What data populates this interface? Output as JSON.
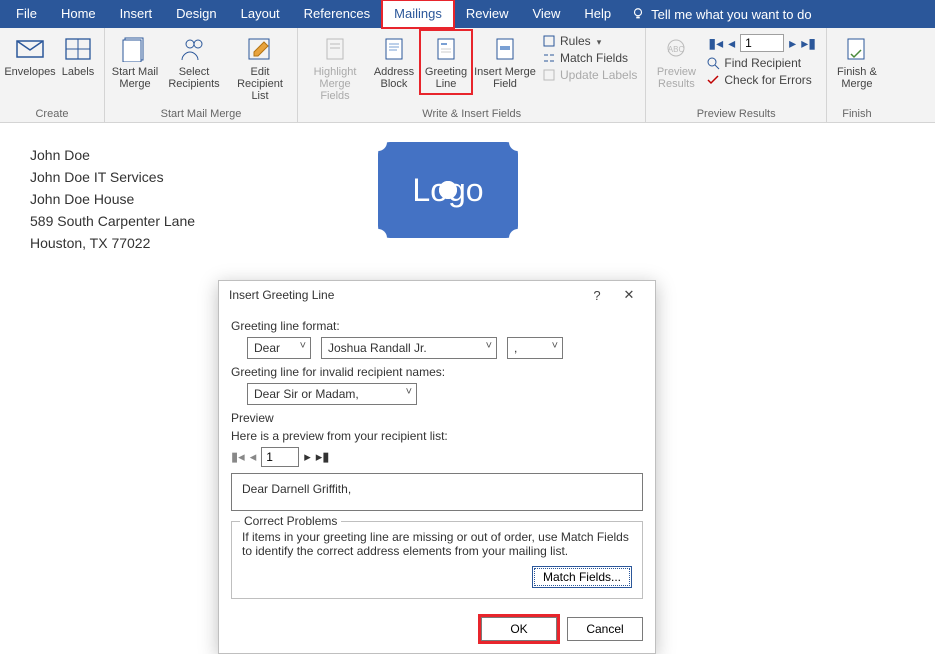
{
  "menubar": {
    "items": [
      "File",
      "Home",
      "Insert",
      "Design",
      "Layout",
      "References",
      "Mailings",
      "Review",
      "View",
      "Help"
    ],
    "active": "Mailings",
    "tell_me": "Tell me what you want to do"
  },
  "ribbon": {
    "create": {
      "label": "Create",
      "envelopes": "Envelopes",
      "labels": "Labels"
    },
    "start": {
      "label": "Start Mail Merge",
      "start_merge": "Start Mail\nMerge",
      "select_recip": "Select\nRecipients",
      "edit_recip": "Edit\nRecipient List"
    },
    "write": {
      "label": "Write & Insert Fields",
      "highlight": "Highlight\nMerge Fields",
      "address": "Address\nBlock",
      "greeting": "Greeting\nLine",
      "insert_merge": "Insert Merge\nField",
      "rules": "Rules",
      "match_fields": "Match Fields",
      "update_labels": "Update Labels"
    },
    "preview": {
      "label": "Preview Results",
      "preview_results": "Preview\nResults",
      "record_num": "1",
      "find_recip": "Find Recipient",
      "check_errors": "Check for Errors"
    },
    "finish": {
      "label": "Finish",
      "finish_merge": "Finish &\nMerge"
    }
  },
  "document": {
    "lines": [
      "John Doe",
      "John Doe IT Services",
      "John Doe House",
      "589 South Carpenter Lane",
      "Houston, TX 77022"
    ],
    "logo_text": "Logo"
  },
  "dialog": {
    "title": "Insert Greeting Line",
    "format_label": "Greeting line format:",
    "salutation": "Dear",
    "name_format": "Joshua Randall Jr.",
    "punct": ",",
    "invalid_label": "Greeting line for invalid recipient names:",
    "invalid_value": "Dear Sir or Madam,",
    "preview_label": "Preview",
    "preview_hint": "Here is a preview from your recipient list:",
    "preview_num": "1",
    "preview_text": "Dear Darnell Griffith,",
    "problems_legend": "Correct Problems",
    "problems_text": "If items in your greeting line are missing or out of order, use Match Fields to identify the correct address elements from your mailing list.",
    "match_fields_btn": "Match Fields...",
    "ok": "OK",
    "cancel": "Cancel"
  }
}
